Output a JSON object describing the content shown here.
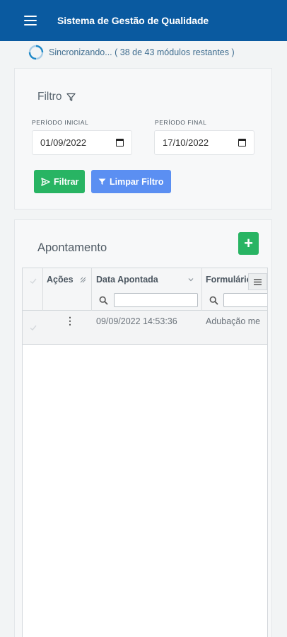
{
  "appbar": {
    "title": "Sistema de Gestão de Qualidade"
  },
  "sync": {
    "text": "Sincronizando... ( 38 de 43 módulos restantes )"
  },
  "filter": {
    "title": "Filtro",
    "start_label": "PERÍODO INICIAL",
    "start_value": "01/09/2022",
    "end_label": "PERÍODO FINAL",
    "end_value": "17/10/2022",
    "filter_button": "Filtrar",
    "clear_button": "Limpar Filtro"
  },
  "list": {
    "title": "Apontamento",
    "add_button": "+",
    "columns": [
      "Ações",
      "Data Apontada",
      "Formulário"
    ],
    "rows": [
      {
        "actions": "⋮",
        "date": "09/09/2022 14:53:36",
        "form": "Adubação me"
      }
    ]
  },
  "colors": {
    "appbar": "#0a5aa0",
    "success": "#28b463",
    "primary_light": "#5b8ff2"
  }
}
